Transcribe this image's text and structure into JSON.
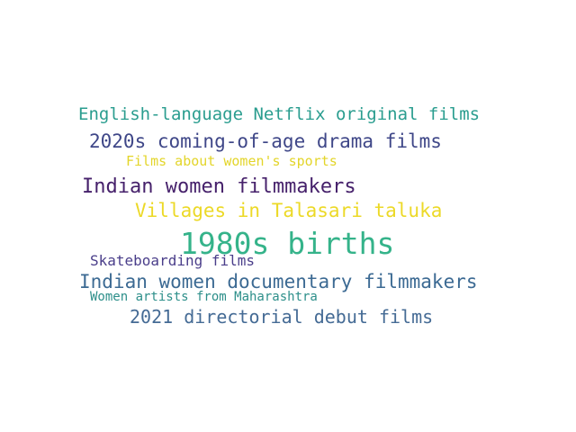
{
  "words": [
    {
      "text": "English-language Netflix original films",
      "color": "#2a9d8f"
    },
    {
      "text": "2020s coming-of-age drama films",
      "color": "#3f4788"
    },
    {
      "text": "Films about women's sports",
      "color": "#e3d52a"
    },
    {
      "text": "Indian women filmmakers",
      "color": "#46216b"
    },
    {
      "text": "Villages in Talasari taluka",
      "color": "#ecd927"
    },
    {
      "text": "1980s births",
      "color": "#35b38a"
    },
    {
      "text": "Skateboarding films",
      "color": "#4a3e8a"
    },
    {
      "text": "Indian women documentary filmmakers",
      "color": "#3c6a93"
    },
    {
      "text": "Women artists from Maharashtra",
      "color": "#2d8f8a"
    },
    {
      "text": "2021 directorial debut films",
      "color": "#456b95"
    }
  ]
}
